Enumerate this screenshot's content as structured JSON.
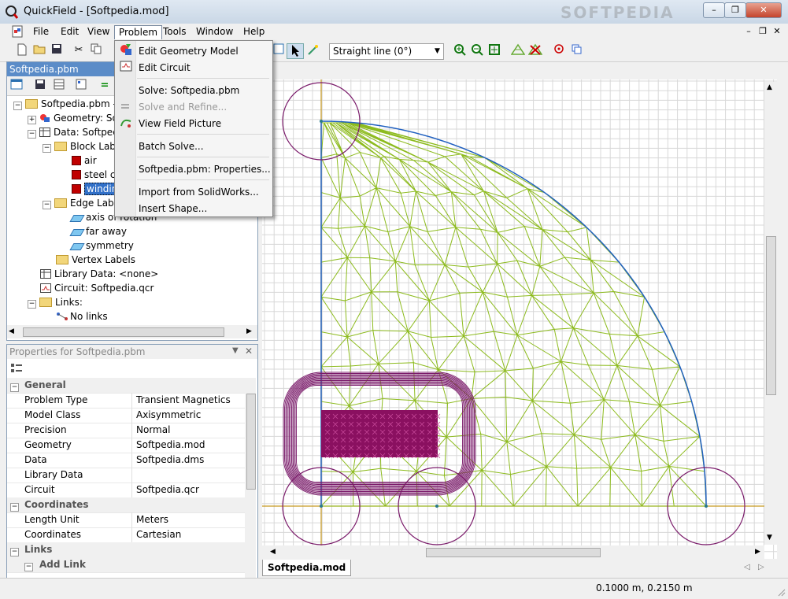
{
  "window": {
    "title": "QuickField - [Softpedia.mod]",
    "controls": [
      "–",
      "❐",
      "✕"
    ],
    "watermark": "SOFTPEDIA"
  },
  "menubar": {
    "items": [
      "File",
      "Edit",
      "View",
      "Problem",
      "Tools",
      "Window",
      "Help"
    ]
  },
  "toolbar": {
    "line_mode": "Straight line (0°)"
  },
  "dropdown": {
    "items": [
      {
        "label": "Edit Geometry Model",
        "disabled": false
      },
      {
        "label": "Edit Circuit",
        "disabled": false
      },
      {
        "label": "Solve: Softpedia.pbm",
        "disabled": false
      },
      {
        "label": "Solve and Refine...",
        "disabled": true
      },
      {
        "label": "View Field Picture",
        "disabled": false
      },
      {
        "label": "Batch Solve...",
        "disabled": false
      },
      {
        "label": "Softpedia.pbm: Properties...",
        "disabled": false
      },
      {
        "label": "Import from SolidWorks...",
        "disabled": false
      },
      {
        "label": "Insert Shape...",
        "disabled": false
      }
    ]
  },
  "tree": {
    "header": "Softpedia.pbm",
    "nodes": [
      "Softpedia.pbm - n",
      "Geometry: Sof",
      "Data: Softpedi",
      "Block Labe",
      "air",
      "steel co",
      "windin",
      "Edge Labe",
      "axis of rotation",
      "far away",
      "symmetry",
      "Vertex Labels",
      "Library Data: <none>",
      "Circuit: Softpedia.qcr",
      "Links:",
      "No links"
    ]
  },
  "properties": {
    "header": "Properties for Softpedia.pbm",
    "rows": [
      {
        "type": "category",
        "label": "General"
      },
      {
        "type": "prop",
        "label": "Problem Type",
        "value": "Transient Magnetics"
      },
      {
        "type": "prop",
        "label": "Model Class",
        "value": "Axisymmetric"
      },
      {
        "type": "prop",
        "label": "Precision",
        "value": "Normal"
      },
      {
        "type": "prop",
        "label": "Geometry",
        "value": "Softpedia.mod"
      },
      {
        "type": "prop",
        "label": "Data",
        "value": "Softpedia.dms"
      },
      {
        "type": "prop",
        "label": "Library Data",
        "value": ""
      },
      {
        "type": "prop",
        "label": "Circuit",
        "value": "Softpedia.qcr"
      },
      {
        "type": "category",
        "label": "Coordinates"
      },
      {
        "type": "prop",
        "label": "Length Unit",
        "value": "Meters"
      },
      {
        "type": "prop",
        "label": "Coordinates",
        "value": "Cartesian"
      },
      {
        "type": "category",
        "label": "Links"
      },
      {
        "type": "category",
        "label": "Add Link"
      }
    ]
  },
  "tabs": {
    "active": "Softpedia.mod"
  },
  "status": {
    "coords": "0.1000 m, 0.2150 m"
  },
  "colors": {
    "mesh": "#8dbb1e",
    "arc": "#2060c0",
    "coil": "#8a1060",
    "circle": "#7a1a6a",
    "axis": "#c89a20"
  }
}
